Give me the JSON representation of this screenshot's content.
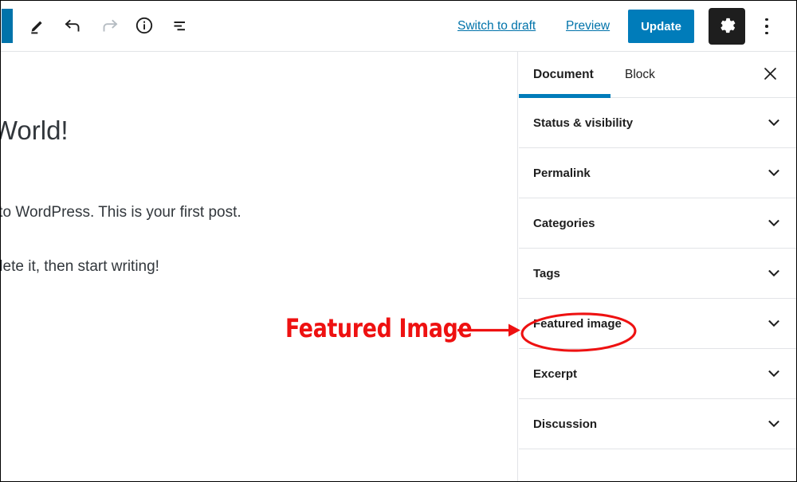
{
  "toolbar": {
    "logo_name": "wordpress-logo",
    "icons": [
      {
        "name": "edit-pencil-icon",
        "label": "Edit"
      },
      {
        "name": "undo-icon",
        "label": "Undo"
      },
      {
        "name": "redo-icon",
        "label": "Redo"
      },
      {
        "name": "info-icon",
        "label": "Details"
      },
      {
        "name": "outline-list-icon",
        "label": "Block navigation"
      }
    ],
    "switch_to_draft": "Switch to draft",
    "preview": "Preview",
    "update": "Update",
    "settings_icon": "gear-icon",
    "more_menu_icon": "kebab-menu-icon"
  },
  "editor": {
    "title": "lo World!",
    "paragraph_1": "ome to WordPress. This is your first post.",
    "paragraph_2": "or delete it, then start writing!"
  },
  "sidebar": {
    "tabs": [
      {
        "label": "Document",
        "active": true
      },
      {
        "label": "Block",
        "active": false
      }
    ],
    "close_icon": "close-icon",
    "panels": [
      {
        "label": "Status & visibility",
        "icon": "chevron-down-icon"
      },
      {
        "label": "Permalink",
        "icon": "chevron-down-icon"
      },
      {
        "label": "Categories",
        "icon": "chevron-down-icon"
      },
      {
        "label": "Tags",
        "icon": "chevron-down-icon"
      },
      {
        "label": "Featured image",
        "icon": "chevron-down-icon",
        "highlighted": true
      },
      {
        "label": "Excerpt",
        "icon": "chevron-down-icon"
      },
      {
        "label": "Discussion",
        "icon": "chevron-down-icon"
      }
    ]
  },
  "annotation": {
    "text": "Featured Image",
    "color": "#ee1111",
    "shapes": [
      "arrow-right",
      "ellipse-highlight"
    ]
  },
  "colors": {
    "accent_blue": "#007cba",
    "logo_blue": "#0073aa",
    "link_blue": "#0073aa",
    "dark_button": "#1e1e1e",
    "border": "#e2e4e7",
    "text": "#1e1e1e",
    "body_text": "#32373c",
    "annotation_red": "#ee1111"
  }
}
